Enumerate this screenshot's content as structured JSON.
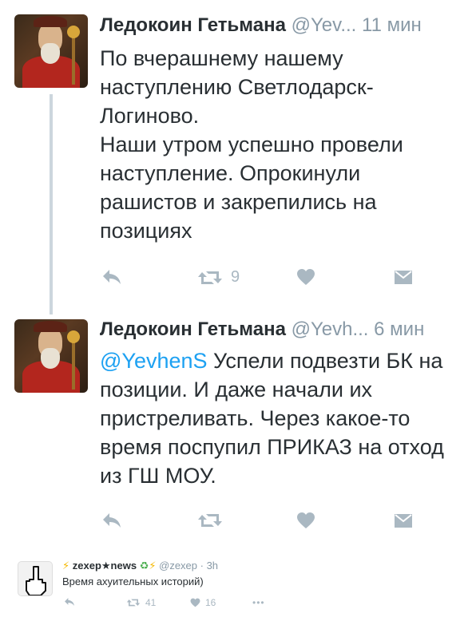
{
  "tweets": [
    {
      "name": "Ледокоин Гетьмана",
      "handle": "@Yev...",
      "time": "11 мин",
      "text": "По вчерашнему нашему наступлению Светлодарск-Логиново.",
      "text2": "Наши утром успешно провели наступление. Опрокинули рашистов и закрепились на позициях",
      "retweet_count": "9",
      "icons": [
        "reply-icon",
        "retweet-icon",
        "like-icon",
        "dm-icon"
      ]
    },
    {
      "name": "Ледокоин Гетьмана",
      "handle": "@Yevh...",
      "time": "6 мин",
      "mention": "@YevhenS",
      "text": " Успели подвезти БК на позиции. И даже начали их пристреливать. Через какое-то время поспупил ПРИКАЗ на отход из ГШ МОУ.",
      "icons": [
        "reply-icon",
        "retweet-icon",
        "like-icon",
        "dm-icon"
      ]
    }
  ],
  "small_tweet": {
    "name_prefix": "⚡ ♻",
    "name": "zexep★news",
    "name_suffix": "♻ ⚡",
    "handle": "@zexep · 3h",
    "text": "Время ахуительных историй)",
    "retweet_count": "41",
    "like_count": "16",
    "more": "•••"
  },
  "colors": {
    "accent": "#1da1f2",
    "muted": "#8899a6",
    "icon": "#aab8c2",
    "line": "#ccd6dd"
  }
}
